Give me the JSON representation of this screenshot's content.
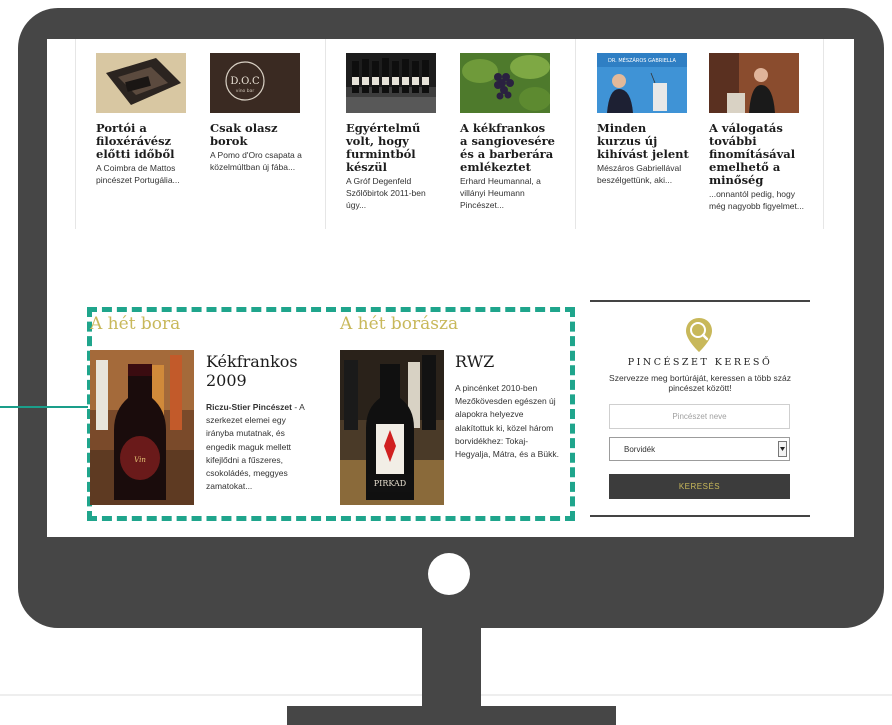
{
  "articles": [
    {
      "title": "Portói a filoxérávész előtti időből",
      "excerpt": "A Coimbra de Mattos pincészet Portugália...",
      "image": "wine-box-photo"
    },
    {
      "title": "Csak olasz borok",
      "excerpt": "A Pomo d'Oro csapata a közelmúltban új fába...",
      "image": "doc-vino-bar-logo-photo",
      "image_text": "D.O.C. vino bar"
    },
    {
      "title": "Egyértelmű volt, hogy furmintból készül",
      "excerpt": "A Gróf Degenfeld Szőlőbirtok 2011-ben úgy...",
      "image": "wine-bottles-photo"
    },
    {
      "title": "A kékfrankos a sangiovesére és a barberára emlékeztet",
      "excerpt": "Erhard Heumannal, a villányi Heumann Pincészet...",
      "image": "grapes-photo"
    },
    {
      "title": "Minden kurzus új kihívást jelent",
      "excerpt": "Mészáros Gabriellával beszélgettünk, aki...",
      "image": "speaker-podium-photo",
      "image_text": "DR. MÉSZÁROS GABRIELLA"
    },
    {
      "title": "A válogatás további finomításával emelhető a minőség",
      "excerpt": "...onnantól pedig, hogy még nagyobb figyelmet...",
      "image": "presenter-photo"
    }
  ],
  "featured": {
    "wine_of_week": {
      "heading": "A hét bora",
      "title": "Kékfrankos 2009",
      "author": "Riczu-Stier Pincészet",
      "text": " - A szerkezet elemei egy irányba mutatnak, és engedik maguk mellett kifejlődni a fűszeres, csokoládés, meggyes zamatokat...",
      "image": "red-wine-bottle-photo"
    },
    "winemaker_of_week": {
      "heading": "A hét borásza",
      "title": "RWZ",
      "text": "A pincénket 2010-ben Mezőkövesden egészen új alapokra helyezve alakítottuk ki, közel három borvidékhez: Tokaj-Hegyalja, Mátra, és a Bükk.",
      "image": "pirkad-wine-bottle-photo",
      "image_text": "PIRKAD"
    }
  },
  "winery_search": {
    "title": "PINCÉSZET KERESŐ",
    "description": "Szervezze meg bortúráját, keressen a több száz pincészet között!",
    "name_placeholder": "Pincészet neve",
    "region_selected": "Borvidék",
    "button_label": "KERESÉS",
    "icon": "search-magnifier-pin-icon"
  },
  "colors": {
    "accent_gold": "#c8b85a",
    "highlight_teal": "#1fa58c",
    "monitor_gray": "#464646",
    "button_dark": "#3c3c3c"
  }
}
